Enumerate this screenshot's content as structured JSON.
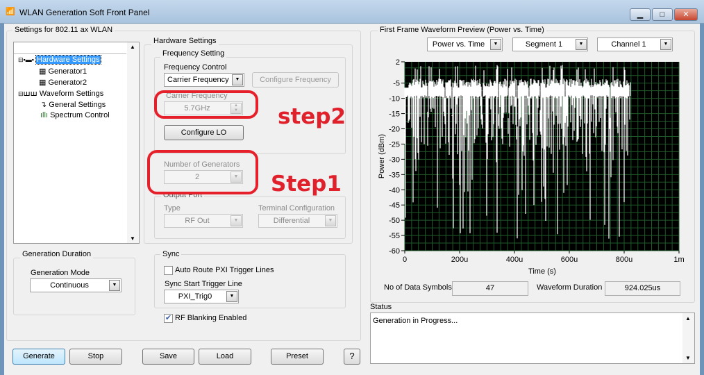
{
  "window": {
    "title": "WLAN Generation Soft Front Panel",
    "minimize": "▁",
    "maximize": "□",
    "close": "✕",
    "app_icon": "antenna-icon"
  },
  "settings": {
    "group_label": "Settings for 802.11 ax WLAN",
    "tree": [
      {
        "label": "Hardware Settings",
        "icon": "hardware-icon",
        "selected": true
      },
      {
        "label": "Generator1",
        "icon": "generator-icon"
      },
      {
        "label": "Generator2",
        "icon": "generator-icon"
      },
      {
        "label": "Waveform Settings",
        "icon": "waveform-icon"
      },
      {
        "label": "General Settings",
        "icon": "trigger-icon"
      },
      {
        "label": "Spectrum Control",
        "icon": "spectrum-icon"
      }
    ],
    "hardware": {
      "group_label": "Hardware Settings",
      "frequency": {
        "group_label": "Frequency Setting",
        "control_label": "Frequency Control",
        "control_value": "Carrier Frequency",
        "configure_button": "Configure Frequency",
        "carrier_label": "Carrier Frequency",
        "carrier_value": "5.7GHz",
        "configure_lo_button": "Configure LO"
      },
      "generators": {
        "label": "Number of Generators",
        "value": "2"
      },
      "output_port": {
        "group_label": "Output Port",
        "type_label": "Type",
        "type_value": "RF Out",
        "terminal_label": "Terminal Configuration",
        "terminal_value": "Differential"
      }
    },
    "duration": {
      "group_label": "Generation Duration",
      "mode_label": "Generation Mode",
      "mode_value": "Continuous"
    },
    "sync": {
      "group_label": "Sync",
      "auto_route_label": "Auto Route PXI Trigger Lines",
      "auto_route_checked": false,
      "start_trigger_label": "Sync Start Trigger Line",
      "start_trigger_value": "PXI_Trig0"
    },
    "rf_blanking": {
      "label": "RF Blanking Enabled",
      "checked": true
    }
  },
  "annotations": {
    "step1": "Step1",
    "step2": "step2",
    "color": "#e5202b"
  },
  "buttons": {
    "generate": "Generate",
    "stop": "Stop",
    "save": "Save",
    "load": "Load",
    "preset": "Preset",
    "help": "?"
  },
  "preview": {
    "group_label": "First Frame Waveform Preview (Power vs. Time)",
    "view_select": "Power vs. Time",
    "segment_select": "Segment 1",
    "channel_select": "Channel 1",
    "data_symbols_label": "No of Data Symbols",
    "data_symbols_value": "47",
    "duration_label": "Waveform Duration",
    "duration_value": "924.025us"
  },
  "chart_data": {
    "type": "line",
    "xlabel": "Time (s)",
    "ylabel": "Power (dBm)",
    "xlim": [
      0,
      0.001
    ],
    "ylim": [
      -60,
      2
    ],
    "xticks": [
      "0",
      "200u",
      "400u",
      "600u",
      "800u",
      "1m"
    ],
    "yticks": [
      "2",
      "-5",
      "-10",
      "-15",
      "-20",
      "-25",
      "-30",
      "-35",
      "-40",
      "-45",
      "-50",
      "-55",
      "-60"
    ],
    "grid": true,
    "background": "#000000",
    "grid_color": "#1f5a2a",
    "trace_color": "#ffffff",
    "signal_end": 0.000825,
    "typical_peak_dBm": -5,
    "floor_dBm": -10,
    "min_dBm": -60
  },
  "status": {
    "label": "Status",
    "text": "Generation in Progress..."
  }
}
